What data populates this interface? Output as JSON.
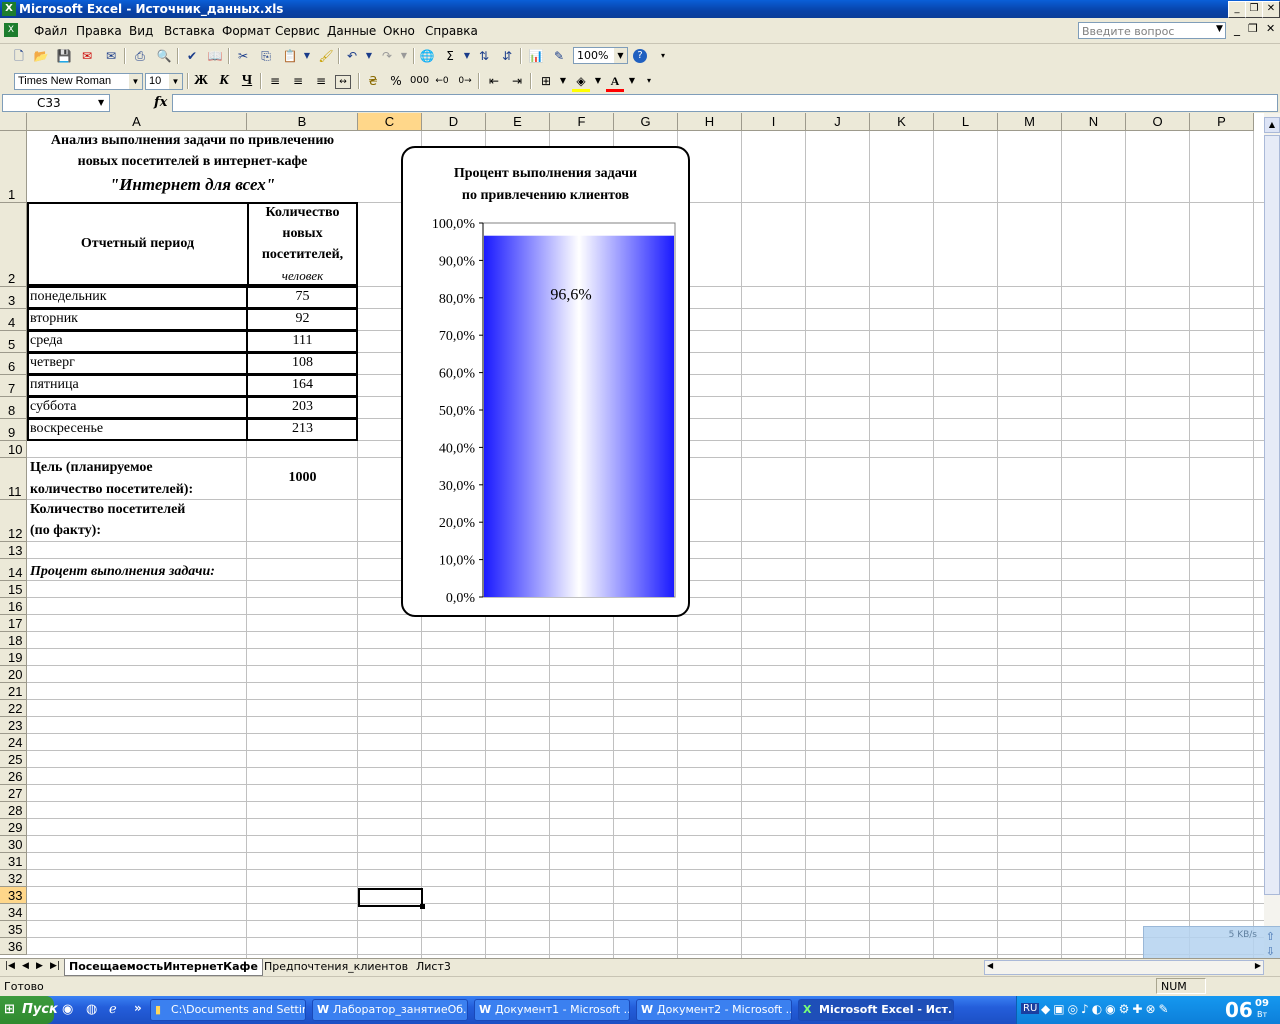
{
  "window": {
    "title": "Microsoft Excel - Источник_данных.xls",
    "app_icon": "excel-icon"
  },
  "menu": {
    "items": [
      "Файл",
      "Правка",
      "Вид",
      "Вставка",
      "Формат",
      "Сервис",
      "Данные",
      "Окно",
      "Справка"
    ],
    "ask_placeholder": "Введите вопрос"
  },
  "toolbar": {
    "zoom": "100%",
    "font_name": "Times New Roman",
    "font_size": "10",
    "bold": "Ж",
    "italic": "К",
    "underline": "Ч",
    "percent": "%",
    "thousands": "000",
    "sigma": "Σ"
  },
  "formula_bar": {
    "name_box": "C33",
    "fx": "fx",
    "formula": ""
  },
  "columns": [
    "A",
    "B",
    "C",
    "D",
    "E",
    "F",
    "G",
    "H",
    "I",
    "J",
    "K",
    "L",
    "M",
    "N",
    "O",
    "P"
  ],
  "selected_column": "C",
  "selected_row": "33",
  "sheet": {
    "title_line1": "Анализ выполнения задачи по привлечению",
    "title_line2": "новых посетителей в интернет-кафе",
    "title_line3": "\"Интернет для всех\"",
    "hdr_period": "Отчетный период",
    "hdr_count_1": "Количество",
    "hdr_count_2": "новых",
    "hdr_count_3": "посетителей,",
    "hdr_count_4": "человек",
    "rows": [
      {
        "day": "понедельник",
        "value": "75"
      },
      {
        "day": "вторник",
        "value": "92"
      },
      {
        "day": "среда",
        "value": "111"
      },
      {
        "day": "четверг",
        "value": "108"
      },
      {
        "day": "пятница",
        "value": "164"
      },
      {
        "day": "суббота",
        "value": "203"
      },
      {
        "day": "воскресенье",
        "value": "213"
      }
    ],
    "goal_label_1": "Цель (планируемое",
    "goal_label_2": "количество посетителей):",
    "goal_value": "1000",
    "fact_label_1": "Количество посетителей",
    "fact_label_2": "(по факту):",
    "percent_label": "Процент выполнения задачи:"
  },
  "chart_data": {
    "type": "bar",
    "title_line1": "Процент выполнения задачи",
    "title_line2": "по привлечению клиентов",
    "categories": [
      ""
    ],
    "values": [
      96.6
    ],
    "data_label": "96,6%",
    "ylim": [
      0,
      100
    ],
    "yticks": [
      "0,0%",
      "10,0%",
      "20,0%",
      "30,0%",
      "40,0%",
      "50,0%",
      "60,0%",
      "70,0%",
      "80,0%",
      "90,0%",
      "100,0%"
    ],
    "bar_color_edge": "#1a1aff",
    "bar_color_center": "#ffffff",
    "grid": false
  },
  "sheet_tabs": [
    "ПосещаемостьИнтернетКафе",
    "Предпочтения_клиентов",
    "Лист3"
  ],
  "active_tab": "ПосещаемостьИнтернетКафе",
  "status": {
    "ready": "Готово",
    "num": "NUM"
  },
  "net_monitor": "5 KB/s",
  "taskbar": {
    "start": "Пуск",
    "buttons": [
      "C:\\Documents and Settin...",
      "Лаборатор_занятиеОб...",
      "Документ1 - Microsoft ...",
      "Документ2 - Microsoft ...",
      "Microsoft Excel - Ист..."
    ],
    "lang": "RU",
    "clock": "06",
    "clock_min": "09",
    "clock_day": "Вт"
  }
}
